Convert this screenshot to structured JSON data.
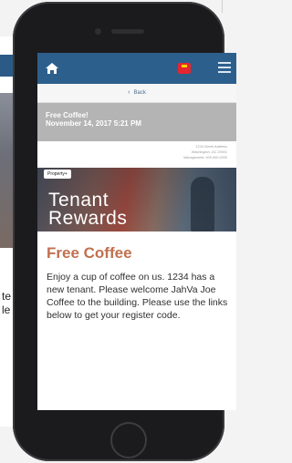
{
  "app": {
    "nav": {
      "home_icon": "home-icon",
      "flag_icon": "flag-icon",
      "menu_icon": "hamburger-menu-icon",
      "nav_color": "#2d5f8c"
    },
    "back_label": "Back",
    "header": {
      "title": "Free Coffee!",
      "date": "November 14, 2017 5:21 PM"
    },
    "address_lines": [
      "1234 Street Address",
      "Washington, DC 20001",
      "Management: 000-000-0000"
    ],
    "hero": {
      "tag": "Property+",
      "line1": "Tenant",
      "line2": "Rewards"
    },
    "article": {
      "heading": "Free Coffee",
      "body": "Enjoy a cup of coffee on us. 1234 has a new tenant. Please welcome JahVa Joe Coffee to the building. Please use the links below to get your register code.",
      "heading_color": "#c1704f"
    }
  },
  "background_page": {
    "line1": "te",
    "line2": "le"
  }
}
